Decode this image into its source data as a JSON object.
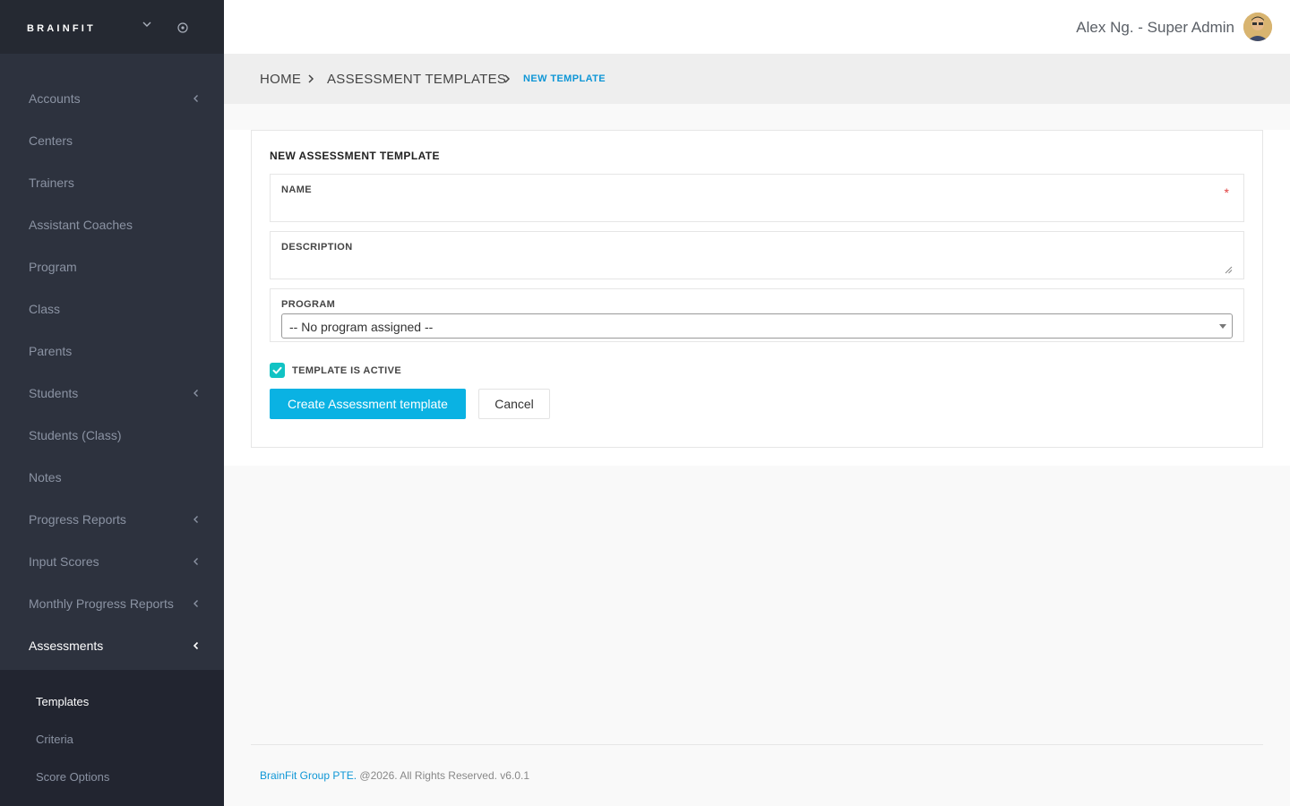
{
  "brand": {
    "logo_text": "BRAINFIT"
  },
  "sidebar": {
    "items": [
      {
        "label": "Accounts",
        "has_children": true
      },
      {
        "label": "Centers",
        "has_children": false
      },
      {
        "label": "Trainers",
        "has_children": false
      },
      {
        "label": "Assistant Coaches",
        "has_children": false
      },
      {
        "label": "Program",
        "has_children": false
      },
      {
        "label": "Class",
        "has_children": false
      },
      {
        "label": "Parents",
        "has_children": false
      },
      {
        "label": "Students",
        "has_children": true
      },
      {
        "label": "Students (Class)",
        "has_children": false
      },
      {
        "label": "Notes",
        "has_children": false
      },
      {
        "label": "Progress Reports",
        "has_children": true
      },
      {
        "label": "Input Scores",
        "has_children": true
      },
      {
        "label": "Monthly Progress Reports",
        "has_children": true
      },
      {
        "label": "Assessments",
        "has_children": true,
        "active": true
      }
    ],
    "submenu": [
      {
        "label": "Templates",
        "active": true
      },
      {
        "label": "Criteria"
      },
      {
        "label": "Score Options"
      }
    ]
  },
  "header": {
    "user_name": "Alex Ng. - Super Admin"
  },
  "breadcrumb": {
    "home": "HOME",
    "section": "ASSESSMENT TEMPLATES",
    "current": "NEW TEMPLATE"
  },
  "form": {
    "title": "NEW ASSESSMENT TEMPLATE",
    "name_label": "NAME",
    "name_value": "",
    "required_mark": "*",
    "description_label": "DESCRIPTION",
    "description_value": "",
    "program_label": "PROGRAM",
    "program_selected": "-- No program assigned --",
    "active_label": "TEMPLATE IS ACTIVE",
    "active_checked": true,
    "submit_label": "Create Assessment template",
    "cancel_label": "Cancel"
  },
  "footer": {
    "company": "BrainFit Group PTE.",
    "rights": " @2026. All Rights Reserved. v6.0.1"
  },
  "colors": {
    "sidebar_bg": "#2d323e",
    "accent": "#0ab2e3",
    "checkbox": "#12c3c4",
    "link": "#0e96d6"
  }
}
